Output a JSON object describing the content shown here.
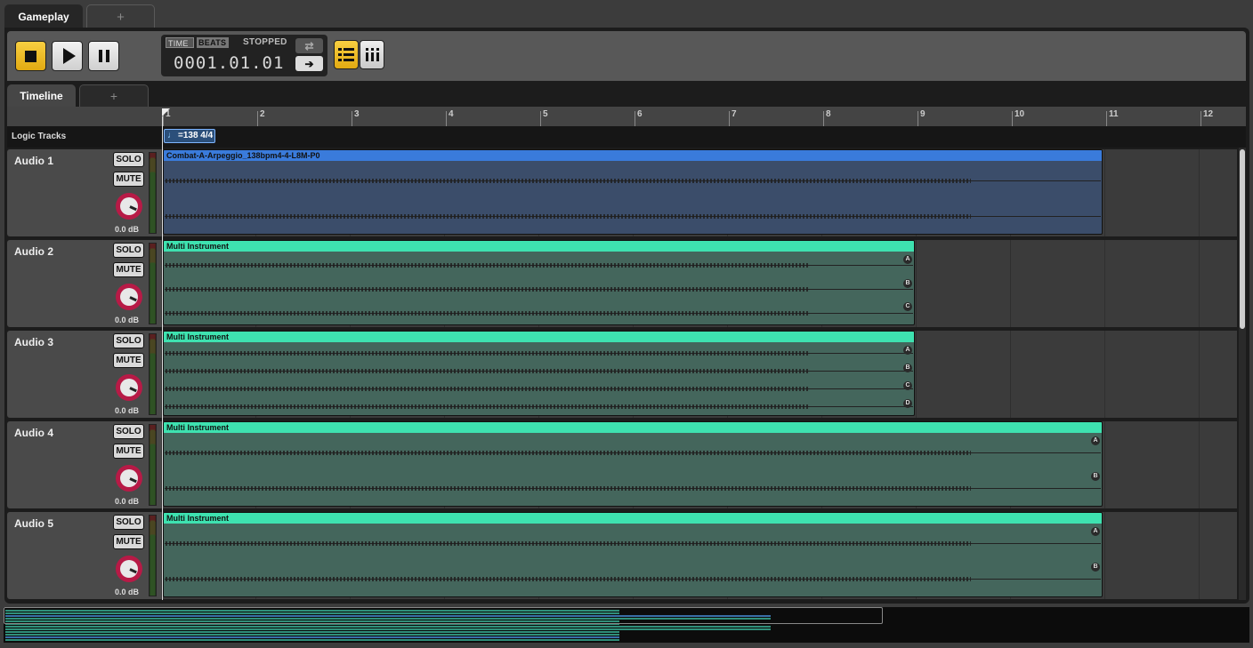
{
  "tabs": {
    "main": "Gameplay",
    "add": "+"
  },
  "transport": {
    "time_mode": "TIME",
    "beats_mode": "BEATS",
    "status": "STOPPED",
    "counter": "0001.01.01",
    "loop_icon": "loop-icon",
    "follow_icon": "arrow-right-icon"
  },
  "view_tabs": {
    "timeline": "Timeline",
    "add": "+"
  },
  "ruler": {
    "marks": [
      "1",
      "2",
      "3",
      "4",
      "5",
      "6",
      "7",
      "8",
      "9",
      "10",
      "11",
      "12"
    ]
  },
  "logic": {
    "label": "Logic Tracks",
    "tempo": "=138 4/4",
    "tempo_icon": "note-icon"
  },
  "tracks": [
    {
      "name": "Audio 1",
      "solo": "SOLO",
      "mute": "MUTE",
      "volume": "0.0 dB",
      "clip": "Combat-A-Arpeggio_138bpm4-4-L8M-P0",
      "channels": []
    },
    {
      "name": "Audio 2",
      "solo": "SOLO",
      "mute": "MUTE",
      "volume": "0.0 dB",
      "clip": "Multi Instrument",
      "channels": [
        "A",
        "B",
        "C"
      ]
    },
    {
      "name": "Audio 3",
      "solo": "SOLO",
      "mute": "MUTE",
      "volume": "0.0 dB",
      "clip": "Multi Instrument",
      "channels": [
        "A",
        "B",
        "C",
        "D"
      ]
    },
    {
      "name": "Audio 4",
      "solo": "SOLO",
      "mute": "MUTE",
      "volume": "0.0 dB",
      "clip": "Multi Instrument",
      "channels": [
        "A",
        "B"
      ]
    },
    {
      "name": "Audio 5",
      "solo": "SOLO",
      "mute": "MUTE",
      "volume": "0.0 dB",
      "clip": "Multi Instrument",
      "channels": [
        "A",
        "B"
      ]
    }
  ],
  "colors": {
    "accent": "#f0bc2a",
    "blue_clip": "#3a7bdb",
    "green_clip": "#3ee2b0",
    "knob": "#b71a46"
  }
}
